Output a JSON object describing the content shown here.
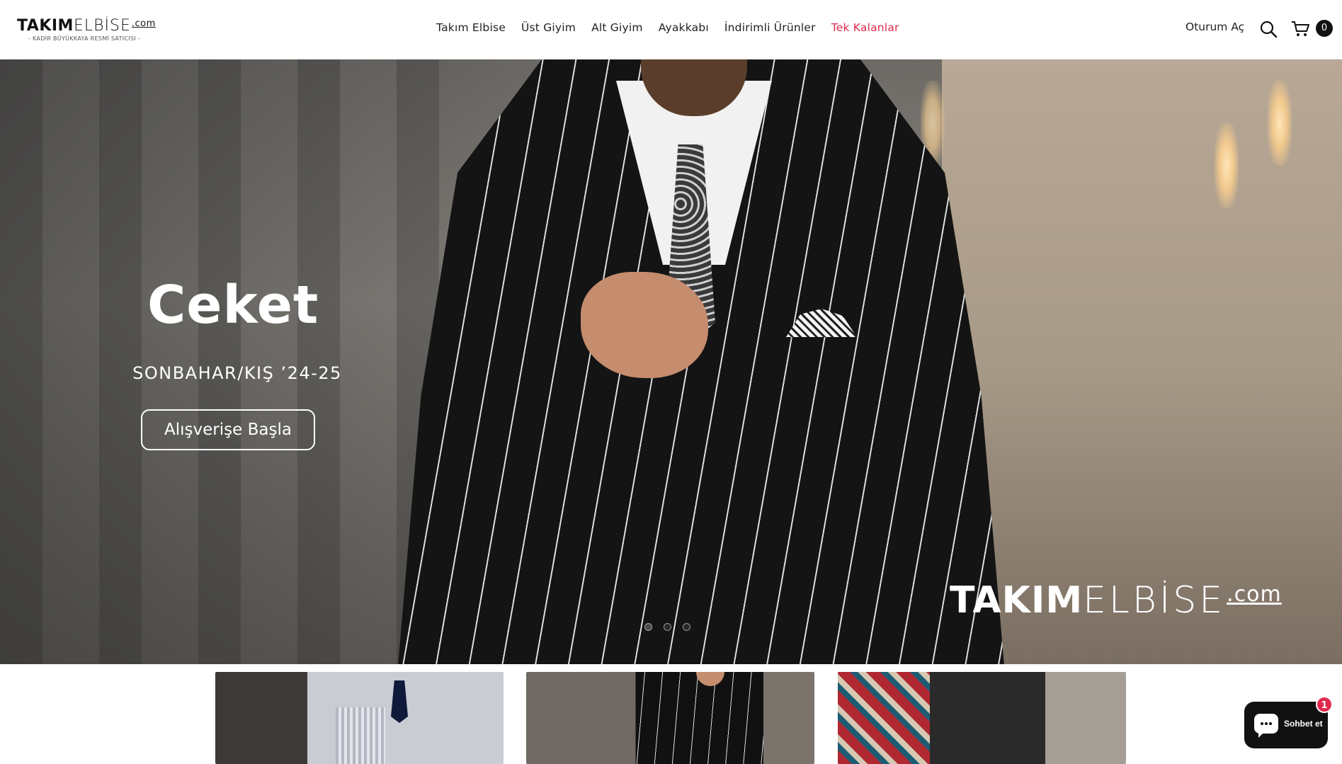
{
  "header": {
    "logo": {
      "brand_bold": "TAKIM",
      "brand_light": "ELBİSE",
      "brand_suffix": ".com",
      "tagline": "- KADİR BÜYÜKKAYA RESMİ SATICISI -"
    },
    "nav": [
      {
        "label": "Takım Elbise"
      },
      {
        "label": "Üst Giyim"
      },
      {
        "label": "Alt Giyim"
      },
      {
        "label": "Ayakkabı"
      },
      {
        "label": "İndirimli Ürünler"
      },
      {
        "label": "Tek Kalanlar",
        "highlight": true
      }
    ],
    "account_label": "Oturum Aç",
    "search_icon": "search-icon",
    "cart_icon": "cart-icon",
    "cart_count": "0",
    "highlight_color": "#e0294d"
  },
  "hero": {
    "title": "Ceket",
    "subtitle": "SONBAHAR/KIŞ ’24-25",
    "cta_label": "Alışverişe Başla",
    "brand_bold": "TAKIM",
    "brand_light": "ELBİSE",
    "brand_suffix": ".com",
    "slides": 3,
    "active_slide": 1
  },
  "chat": {
    "label": "Sohbet et",
    "badge": "1",
    "icon": "chat-bubble-icon"
  }
}
